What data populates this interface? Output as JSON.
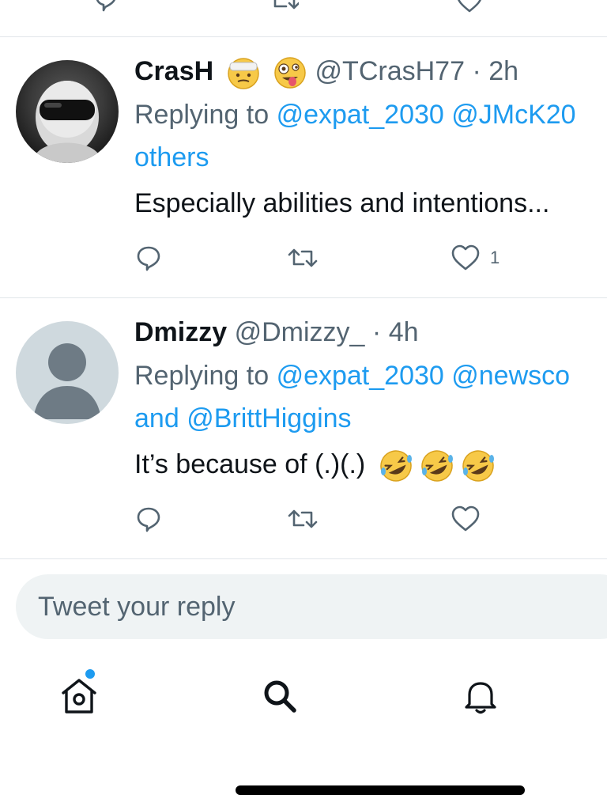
{
  "tweets": [
    {
      "display_name": "CrasH",
      "emojis": [
        "face-with-head-bandage",
        "zany-face"
      ],
      "handle": "@TCrasH77",
      "separator": "·",
      "time": "2h",
      "replying_prefix": "Replying to",
      "replying_mentions": [
        "@expat_2030",
        "@JMcK20"
      ],
      "replying_more": "others",
      "text": "Especially abilities and intentions...",
      "like_count": "1"
    },
    {
      "display_name": "Dmizzy",
      "handle": "@Dmizzy_",
      "separator": "·",
      "time": "4h",
      "replying_prefix": "Replying to",
      "replying_mentions": [
        "@expat_2030",
        "@newsco"
      ],
      "replying_and": "and",
      "replying_last": "@BrittHiggins",
      "text": "It’s because of (.)(.)",
      "text_emojis": [
        "rolling-on-the-floor-laughing",
        "rolling-on-the-floor-laughing",
        "rolling-on-the-floor-laughing"
      ]
    }
  ],
  "reply_box": {
    "placeholder": "Tweet your reply"
  },
  "tabbar": {
    "items": [
      "home-icon",
      "search-icon",
      "notifications-icon"
    ],
    "home_has_new": true
  },
  "colors": {
    "accent": "#1d9bf0",
    "secondary_text": "#536471",
    "divider": "#e1e6ea",
    "reply_box_bg": "#eff3f4"
  }
}
